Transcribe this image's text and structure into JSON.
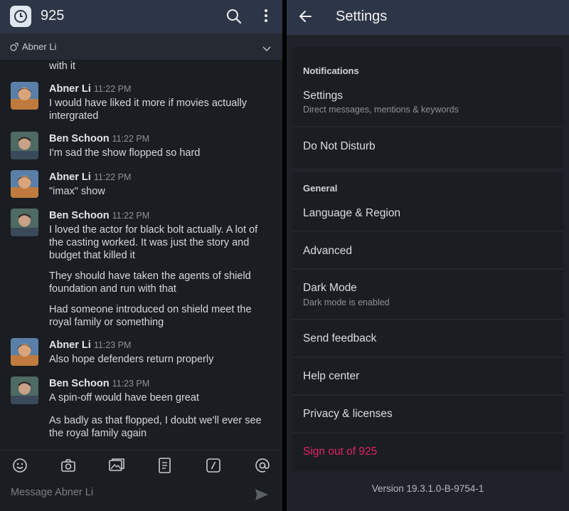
{
  "left": {
    "header": {
      "title": "925"
    },
    "subheader": {
      "name": "Abner Li"
    },
    "messages": [
      {
        "continuation": "with it"
      },
      {
        "author": "Abner Li",
        "time": "11:22 PM",
        "lines": [
          "I would have liked it more if movies actually intergrated"
        ]
      },
      {
        "author": "Ben Schoon",
        "time": "11:22 PM",
        "lines": [
          "I'm sad the show flopped so hard"
        ]
      },
      {
        "author": "Abner Li",
        "time": "11:22 PM",
        "lines": [
          "\"imax\" show"
        ]
      },
      {
        "author": "Ben Schoon",
        "time": "11:22 PM",
        "lines": [
          "I loved the actor for black bolt actually. A lot of the casting worked. It was just the story and budget that killed it",
          "They should have taken the agents of shield foundation and run with that",
          "Had someone introduced on shield meet the royal family or something"
        ]
      },
      {
        "author": "Abner Li",
        "time": "11:23 PM",
        "lines": [
          "Also hope defenders return properly"
        ]
      },
      {
        "author": "Ben Schoon",
        "time": "11:23 PM",
        "lines": [
          "A spin-off would have been great",
          "As badly as that flopped, I doubt we'll ever see the royal family again"
        ]
      }
    ],
    "composer": {
      "placeholder": "Message Abner Li",
      "tools": [
        "emoji-icon",
        "camera-icon",
        "gallery-icon",
        "files-icon",
        "slash-command-icon",
        "mention-icon"
      ]
    }
  },
  "right": {
    "header": {
      "title": "Settings"
    },
    "sections": [
      {
        "heading": "Notifications",
        "items": [
          {
            "title": "Settings",
            "subtitle": "Direct messages, mentions & keywords"
          },
          {
            "title": "Do Not Disturb"
          }
        ]
      },
      {
        "heading": "General",
        "items": [
          {
            "title": "Language & Region"
          },
          {
            "title": "Advanced"
          },
          {
            "title": "Dark Mode",
            "subtitle": "Dark mode is enabled"
          },
          {
            "title": "Send feedback"
          },
          {
            "title": "Help center"
          },
          {
            "title": "Privacy & licenses"
          },
          {
            "title": "Sign out of 925"
          }
        ]
      }
    ],
    "version": "Version 19.3.1.0-B-9754-1"
  },
  "colors": {
    "header": "#2c3647",
    "background": "#1a1d21",
    "signout": "#e0245e"
  }
}
